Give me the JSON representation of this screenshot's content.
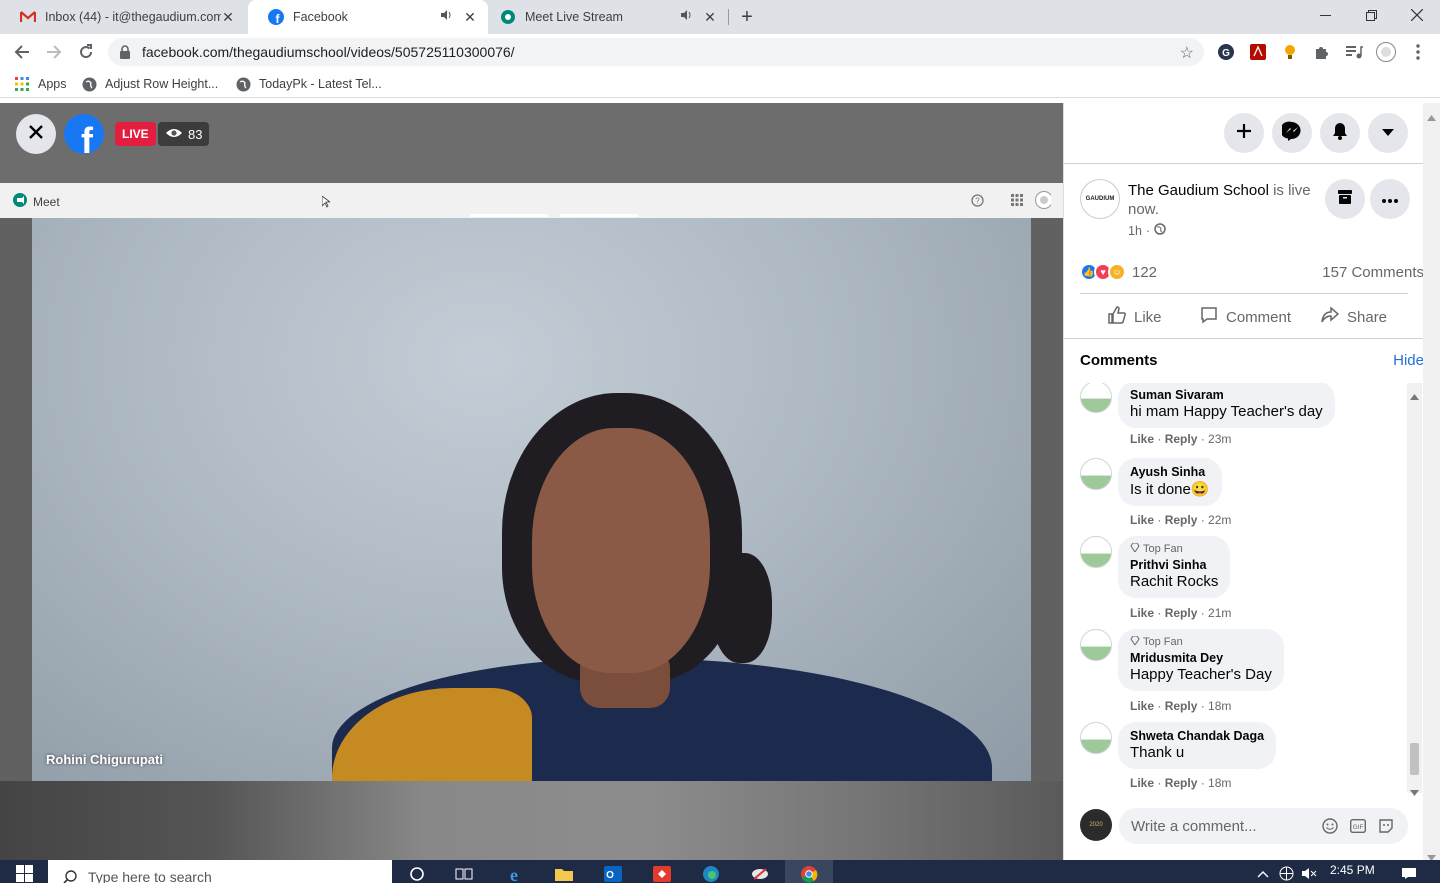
{
  "browser": {
    "tabs": [
      {
        "title": "Inbox (44) - it@thegaudium.com",
        "icon": "gmail-icon"
      },
      {
        "title": "Facebook",
        "icon": "facebook-icon"
      },
      {
        "title": "Meet Live Stream",
        "icon": "meet-icon"
      }
    ],
    "url": "facebook.com/thegaudiumschool/videos/505725110300076/",
    "bookmarks": [
      {
        "label": "Apps",
        "icon": "apps-grid-icon"
      },
      {
        "label": "Adjust Row Height...",
        "icon": "globe-icon"
      },
      {
        "label": "TodayPk - Latest Tel...",
        "icon": "globe-icon"
      }
    ]
  },
  "video": {
    "live_label": "LIVE",
    "viewer_count": "83",
    "meet_label": "Meet",
    "participant_name": "Rohini Chigurupati"
  },
  "post": {
    "page_name": "The Gaudium School",
    "status": "is live now.",
    "time": "1h",
    "avatar_text": "GAUDIUM",
    "reaction_count": "122",
    "comments_count": "157 Comments",
    "actions": {
      "like": "Like",
      "comment": "Comment",
      "share": "Share"
    }
  },
  "comments": {
    "heading": "Comments",
    "hide": "Hide",
    "items": [
      {
        "author": "Suman Sivaram",
        "text": "hi mam Happy Teacher's day",
        "top_fan": "",
        "like": "Like",
        "reply": "Reply",
        "time": "23m"
      },
      {
        "author": "Ayush Sinha",
        "text": "Is it done😀",
        "top_fan": "",
        "like": "Like",
        "reply": "Reply",
        "time": "22m"
      },
      {
        "author": "Prithvi Sinha",
        "text": "Rachit Rocks",
        "top_fan": "Top Fan",
        "like": "Like",
        "reply": "Reply",
        "time": "21m"
      },
      {
        "author": "Mridusmita Dey",
        "text": "Happy Teacher's Day",
        "top_fan": "Top Fan",
        "like": "Like",
        "reply": "Reply",
        "time": "18m"
      },
      {
        "author": "Shweta Chandak Daga",
        "text": "Thank u",
        "top_fan": "",
        "like": "Like",
        "reply": "Reply",
        "time": "18m"
      }
    ],
    "write_placeholder": "Write a comment...",
    "composer_avatar_text": "2020"
  },
  "taskbar": {
    "search_placeholder": "Type here to search",
    "time": "2:45 PM"
  },
  "colors": {
    "facebook_blue": "#1877f2",
    "live_red": "#e41e3f",
    "link_blue": "#216fdb",
    "taskbar": "#1f2a44"
  }
}
